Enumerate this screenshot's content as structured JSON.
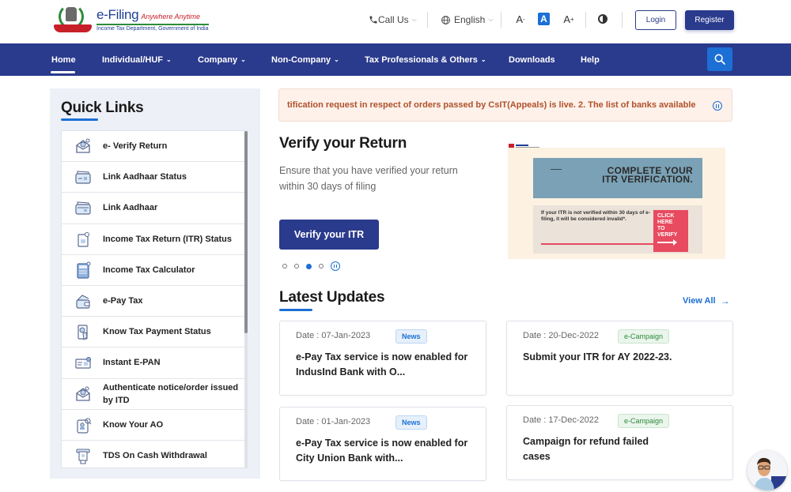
{
  "header": {
    "logo": {
      "title": "e-Filing",
      "tagline": "Anywhere Anytime",
      "department": "Income Tax Department, Government of India"
    },
    "call_us": "Call Us",
    "language": "English",
    "font_decrease": "A",
    "font_default": "A",
    "font_increase": "A",
    "login": "Login",
    "register": "Register"
  },
  "nav": {
    "items": [
      {
        "label": "Home",
        "active": true,
        "dropdown": false
      },
      {
        "label": "Individual/HUF",
        "dropdown": true
      },
      {
        "label": "Company",
        "dropdown": true
      },
      {
        "label": "Non-Company",
        "dropdown": true
      },
      {
        "label": "Tax Professionals & Others",
        "dropdown": true
      },
      {
        "label": "Downloads",
        "dropdown": false
      },
      {
        "label": "Help",
        "dropdown": false
      }
    ]
  },
  "quick_links": {
    "title": "Quick Links",
    "items": [
      {
        "label": "e- Verify Return",
        "icon": "envelope-verify-icon"
      },
      {
        "label": "Link Aadhaar Status",
        "icon": "aadhaar-card-icon"
      },
      {
        "label": "Link Aadhaar",
        "icon": "aadhaar-link-icon"
      },
      {
        "label": "Income Tax Return (ITR) Status",
        "icon": "document-status-icon"
      },
      {
        "label": "Income Tax Calculator",
        "icon": "calculator-icon"
      },
      {
        "label": "e-Pay Tax",
        "icon": "wallet-icon"
      },
      {
        "label": "Know Tax Payment Status",
        "icon": "payment-status-icon"
      },
      {
        "label": "Instant E-PAN",
        "icon": "pan-card-icon"
      },
      {
        "label": "Authenticate notice/order issued by ITD",
        "icon": "envelope-authenticate-icon"
      },
      {
        "label": "Know Your AO",
        "icon": "officer-document-icon"
      },
      {
        "label": "TDS On Cash Withdrawal",
        "icon": "atm-withdrawal-icon"
      }
    ]
  },
  "ticker": {
    "text": "tification request in respect of orders passed by CsIT(Appeals) is live. 2. The list of banks available"
  },
  "hero": {
    "title": "Verify your Return",
    "description": "Ensure that you have verified your return within 30 days of filing",
    "button": "Verify your ITR",
    "slides_total": 4,
    "active_slide": 3
  },
  "banner": {
    "heading_line1": "COMPLETE YOUR",
    "heading_line2": "ITR VERIFICATION.",
    "body": "If your ITR is not verified within 30 days of e-filing, it will be considered invalid*.",
    "cta_lines": [
      "CLICK",
      "HERE",
      "TO",
      "VERIFY"
    ]
  },
  "latest_updates": {
    "title": "Latest Updates",
    "view_all": "View All",
    "cards": [
      {
        "date": "Date : 07-Jan-2023",
        "badge": "News",
        "text": "e-Pay Tax service is now enabled for IndusInd Bank with O..."
      },
      {
        "date": "Date : 20-Dec-2022",
        "badge": "e-Campaign",
        "text": "Submit your ITR for AY 2022-23."
      },
      {
        "date": "Date : 01-Jan-2023",
        "badge": "News",
        "text": "e-Pay Tax service is now enabled for City Union Bank with..."
      },
      {
        "date": "Date : 17-Dec-2022",
        "badge": "e-Campaign",
        "text": "Campaign for refund failed cases"
      }
    ]
  },
  "colors": {
    "brand_navy": "#2a3a8c",
    "accent_blue": "#1c6fd4",
    "ticker_text": "#b1502a",
    "campaign_green": "#2e8b3a"
  }
}
